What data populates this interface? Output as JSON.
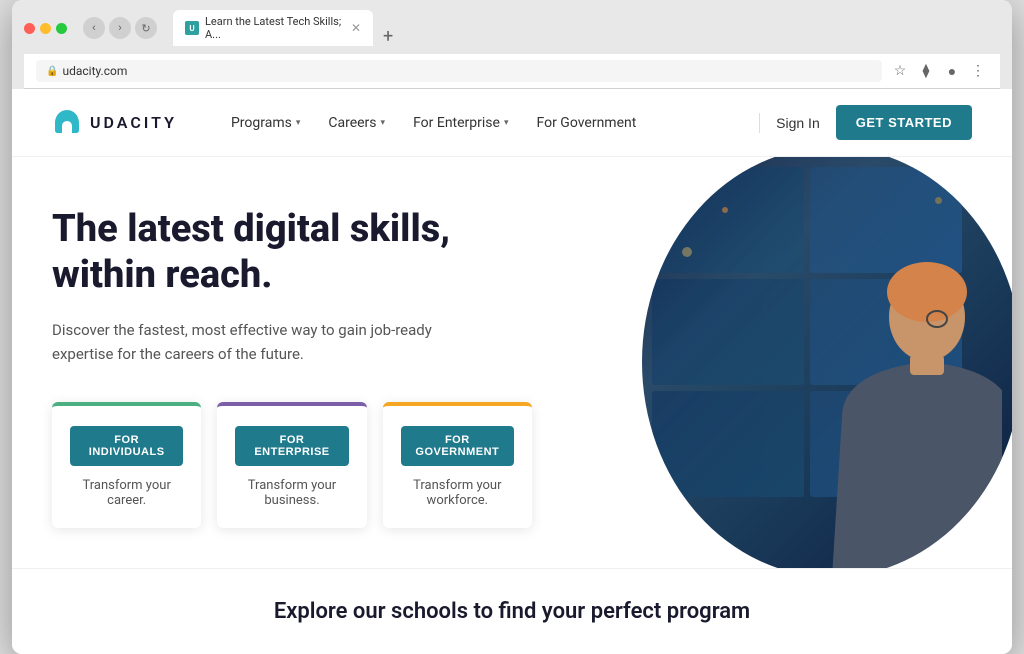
{
  "browser": {
    "tab_title": "Learn the Latest Tech Skills; A...",
    "url": "udacity.com",
    "close_icon": "✕",
    "new_tab_icon": "+",
    "back_icon": "‹",
    "forward_icon": "›",
    "refresh_icon": "↻",
    "lock_icon": "🔒",
    "star_icon": "☆",
    "extension_icon": "⧫",
    "profile_icon": "●",
    "menu_icon": "⋮"
  },
  "nav": {
    "logo_text": "UDACITY",
    "programs_label": "Programs",
    "careers_label": "Careers",
    "enterprise_label": "For Enterprise",
    "government_label": "For Government",
    "sign_in_label": "Sign In",
    "get_started_label": "GET STARTED"
  },
  "hero": {
    "title_line1": "The latest digital skills,",
    "title_line2": "within reach.",
    "subtitle": "Discover the fastest, most effective way to gain job-ready expertise for the careers of the future."
  },
  "cards": [
    {
      "id": "individuals",
      "button_label": "FOR INDIVIDUALS",
      "description": "Transform your career.",
      "border_color": "#4caf82"
    },
    {
      "id": "enterprise",
      "button_label": "FOR ENTERPRISE",
      "description": "Transform your business.",
      "border_color": "#7b5ea7"
    },
    {
      "id": "government",
      "button_label": "FOR GOVERNMENT",
      "description": "Transform your workforce.",
      "border_color": "#f5a623"
    }
  ],
  "bottom": {
    "title": "Explore our schools to find your perfect program"
  }
}
